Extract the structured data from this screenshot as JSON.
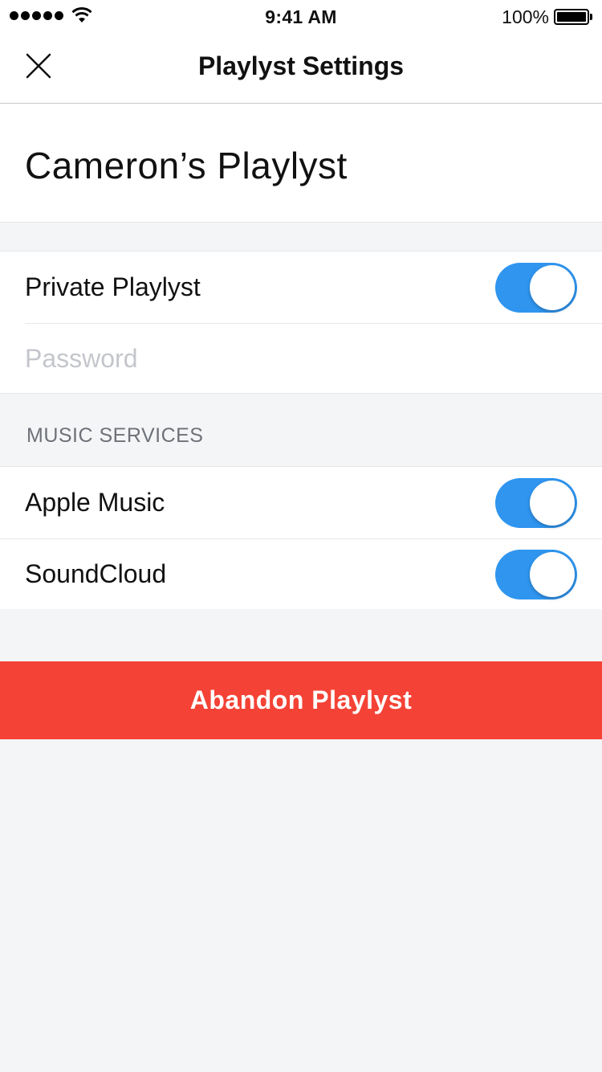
{
  "status_bar": {
    "time": "9:41 AM",
    "battery_percent": "100%",
    "signal_icon": "signal-dots-icon",
    "wifi_icon": "wifi-icon",
    "battery_icon": "battery-icon"
  },
  "nav": {
    "title": "Playlyst Settings",
    "close_icon": "close-icon"
  },
  "playlist": {
    "name": "Cameron’s Playlyst"
  },
  "privacy": {
    "private_label": "Private Playlyst",
    "private_enabled": true,
    "password_placeholder": "Password",
    "password_value": ""
  },
  "music_services": {
    "header": "MUSIC SERVICES",
    "items": [
      {
        "label": "Apple Music",
        "enabled": true
      },
      {
        "label": "SoundCloud",
        "enabled": true
      }
    ]
  },
  "actions": {
    "abandon_label": "Abandon Playlyst"
  },
  "colors": {
    "accent": "#2f95ef",
    "danger": "#f44336",
    "background": "#f4f5f7",
    "section_header": "#6e7178",
    "placeholder": "#c4c6cc"
  }
}
